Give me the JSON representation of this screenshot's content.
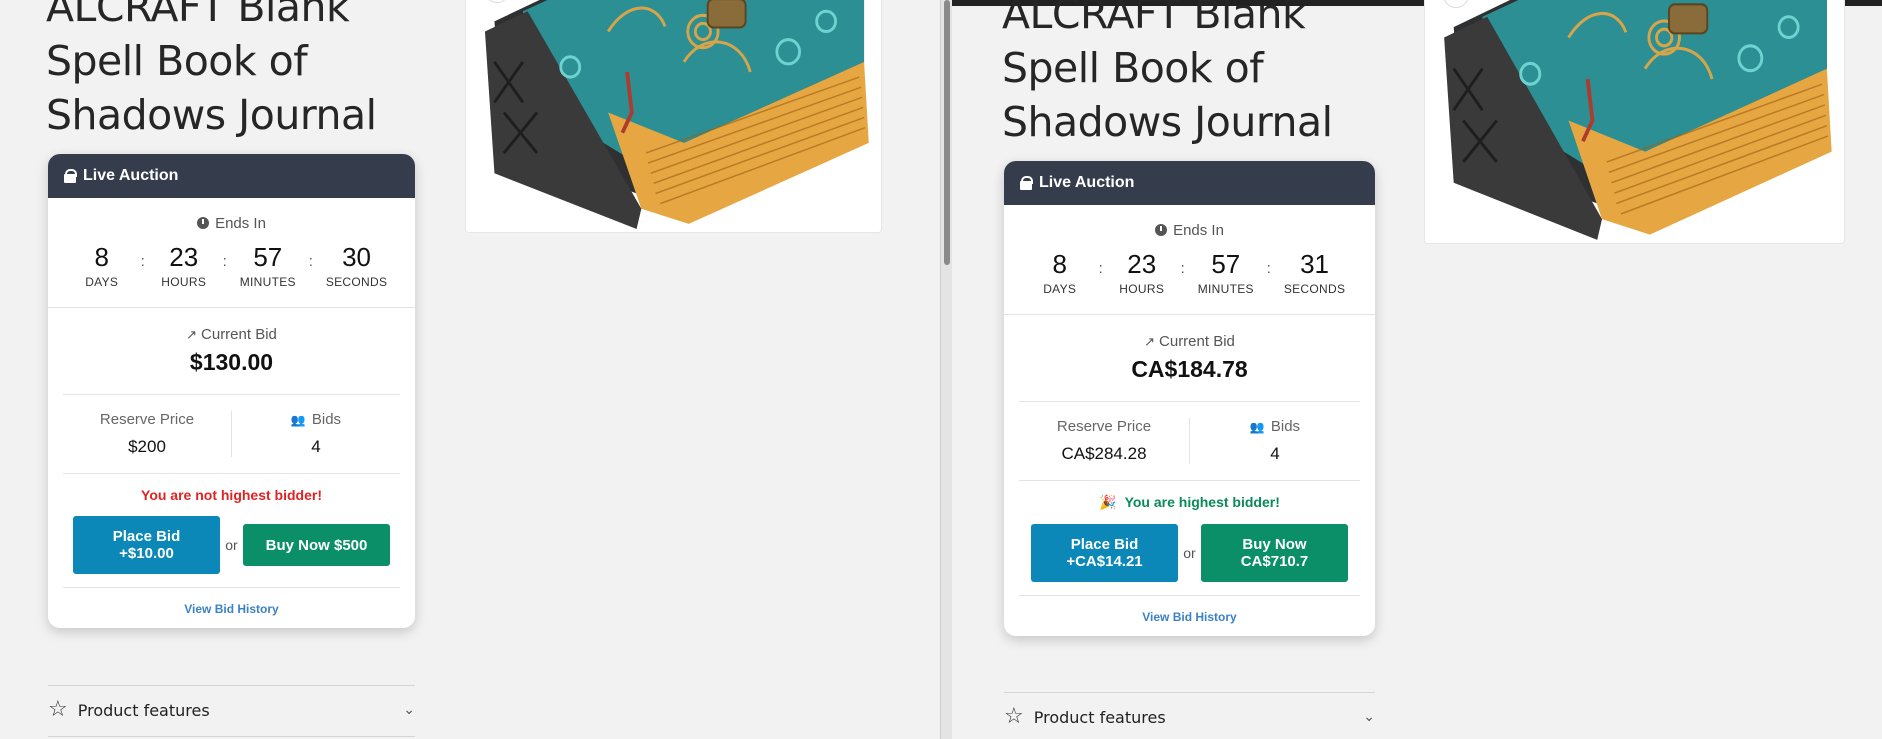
{
  "left": {
    "title_lines": [
      "ALCRAFT Blank",
      "Spell Book of",
      "Shadows Journal"
    ],
    "auction": {
      "header": "Live Auction",
      "ends_label": "Ends In",
      "countdown": [
        {
          "value": "8",
          "label": "DAYS"
        },
        {
          "value": "23",
          "label": "HOURS"
        },
        {
          "value": "57",
          "label": "MINUTES"
        },
        {
          "value": "30",
          "label": "SECONDS"
        }
      ],
      "separator": ":",
      "current_bid_label": "Current Bid",
      "current_bid": "$130.00",
      "reserve_label": "Reserve Price",
      "reserve_value": "$200",
      "bids_label": "Bids",
      "bids_value": "4",
      "status": "You are not highest bidder!",
      "place_bid": [
        "Place Bid",
        "+$10.00"
      ],
      "or": "or",
      "buy_now": "Buy Now $500",
      "history": "View Bid History"
    },
    "features": "Product features"
  },
  "right": {
    "title_lines": [
      "ALCRAFT Blank",
      "Spell Book of",
      "Shadows Journal"
    ],
    "auction": {
      "header": "Live Auction",
      "ends_label": "Ends In",
      "countdown": [
        {
          "value": "8",
          "label": "DAYS"
        },
        {
          "value": "23",
          "label": "HOURS"
        },
        {
          "value": "57",
          "label": "MINUTES"
        },
        {
          "value": "31",
          "label": "SECONDS"
        }
      ],
      "separator": ":",
      "current_bid_label": "Current Bid",
      "current_bid": "CA$184.78",
      "reserve_label": "Reserve Price",
      "reserve_value": "CA$284.28",
      "bids_label": "Bids",
      "bids_value": "4",
      "status_icon": "🎉",
      "status": "You are highest bidder!",
      "place_bid": [
        "Place Bid",
        "+CA$14.21"
      ],
      "or": "or",
      "buy_now": [
        "Buy Now",
        "CA$710.7"
      ],
      "history": "View Bid History"
    },
    "features": "Product features"
  },
  "icons": {
    "lock": "lock-icon",
    "clock": "clock-icon",
    "trend": "trending-up-icon",
    "users": "users-icon",
    "star": "star-icon",
    "chevron": "chevron-down-icon",
    "zoom": "zoom-icon"
  },
  "colors": {
    "header_bg": "#353d4d",
    "bid_button": "#0b88b7",
    "buy_button": "#0b8f68",
    "status_negative": "#e02424",
    "status_positive": "#0a8a5a",
    "link": "#3b82c4"
  }
}
